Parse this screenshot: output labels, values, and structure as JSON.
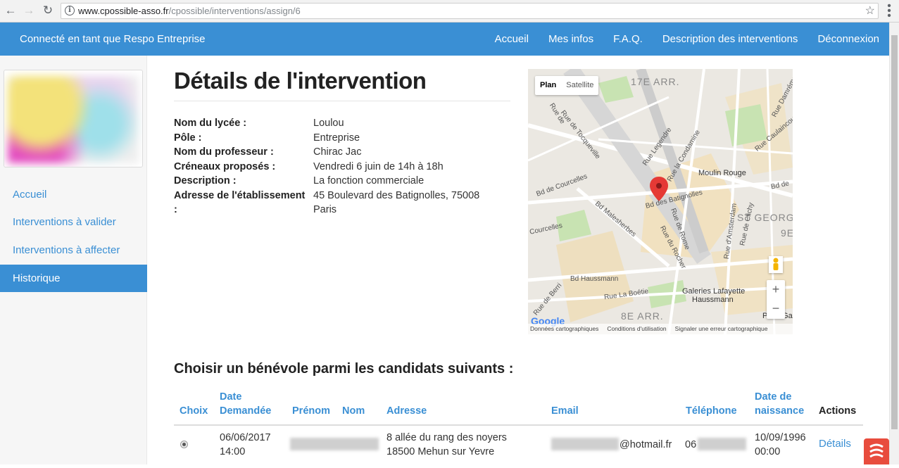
{
  "browser": {
    "url_host": "www.cpossible-asso.fr",
    "url_path": "/cpossible/interventions/assign/6"
  },
  "topnav": {
    "user_label": "Connecté en tant que Respo Entreprise",
    "links": [
      "Accueil",
      "Mes infos",
      "F.A.Q.",
      "Description des interventions",
      "Déconnexion"
    ]
  },
  "sidebar": {
    "items": [
      {
        "label": "Accueil"
      },
      {
        "label": "Interventions à valider"
      },
      {
        "label": "Interventions à affecter"
      },
      {
        "label": "Historique",
        "active": true
      }
    ]
  },
  "main": {
    "title": "Détails de l'intervention",
    "details": [
      {
        "label": "Nom du lycée :",
        "value": "Loulou"
      },
      {
        "label": "Pôle :",
        "value": "Entreprise"
      },
      {
        "label": "Nom du professeur :",
        "value": "Chirac Jac"
      },
      {
        "label": "Créneaux proposés :",
        "value": "Vendredi 6 juin de 14h à 18h"
      },
      {
        "label": "Description :",
        "value": "La fonction commerciale"
      },
      {
        "label": "Adresse de l'établissement",
        "label_cont": ":",
        "value": "45 Boulevard des Batignolles, 75008",
        "value_cont": "Paris"
      }
    ]
  },
  "map": {
    "type_options": [
      "Plan",
      "Satellite"
    ],
    "selected_type": "Plan",
    "labels": {
      "arr17": "17E ARR.",
      "arr8": "8E ARR.",
      "st_george": "ST GEORGE",
      "nine": "9E",
      "moulin_rouge": "Moulin Rouge",
      "galeries1": "Galeries Lafayette",
      "galeries2": "Haussmann",
      "paris_ga": "Paris Ga",
      "bd_batignolles": "Bd des Batignolles",
      "rue_rome": "Rue de Rome",
      "rue_rocher": "Rue du Rocher",
      "bd_haussmann": "Bd Haussmann",
      "rue_boetie": "Rue La Boétie",
      "bd_malesherbes": "Bd Malesherbes",
      "rue_tocqueville": "Rue de Tocqueville",
      "rue_legendre": "Rue Legendre",
      "rue_condamine": "Rue la Condamine",
      "courcelles": "Courcelles",
      "rue_amsterdam": "Rue d'Amsterdam",
      "rue_clichy": "Rue de Clichy",
      "rue_berri": "Rue de Berri",
      "rue_caulaincourt": "Rue Caulaincourt",
      "rue_damremont": "Rue Damrémont",
      "rue_de": "Rue de",
      "bd_de": "Bd de",
      "bd_courcelles": "Bd de Courcelles"
    },
    "zoom_in": "+",
    "zoom_out": "−",
    "google": "Google",
    "footer": [
      "Données cartographiques",
      "Conditions d'utilisation",
      "Signaler une erreur cartographique"
    ]
  },
  "candidates": {
    "title": "Choisir un bénévole parmi les candidats suivants :",
    "headers": {
      "choix": "Choix",
      "date1": "Date",
      "date2": "Demandée",
      "prenom": "Prénom",
      "nom": "Nom",
      "adresse": "Adresse",
      "email": "Email",
      "telephone": "Téléphone",
      "naissance1": "Date de",
      "naissance2": "naissance",
      "actions": "Actions"
    },
    "rows": [
      {
        "date_line1": "06/06/2017",
        "date_line2": "14:00",
        "address_line1": "8 allée du rang des noyers",
        "address_line2": "18500 Mehun sur Yevre",
        "email_suffix": "@hotmail.fr",
        "phone_prefix": "06",
        "birth_line1": "10/09/1996",
        "birth_line2": "00:00",
        "action": "Détails"
      }
    ]
  },
  "colors": {
    "primary": "#3a8fd4",
    "fab": "#e84c3d"
  }
}
